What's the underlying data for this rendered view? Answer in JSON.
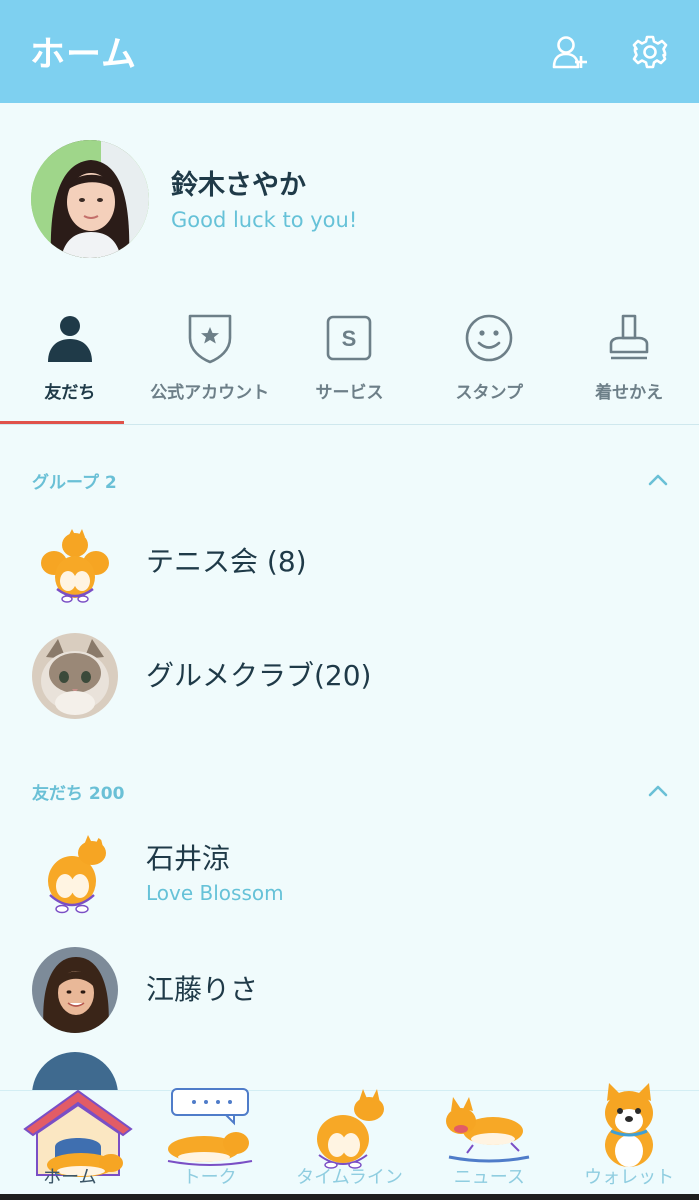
{
  "header": {
    "title": "ホーム",
    "icons": [
      "add-friend-icon",
      "settings-icon"
    ]
  },
  "profile": {
    "name": "鈴木さやか",
    "status": "Good luck to you!"
  },
  "tabs": [
    {
      "label": "友だち",
      "icon": "person-icon",
      "active": true
    },
    {
      "label": "公式アカウント",
      "icon": "official-account-icon",
      "active": false
    },
    {
      "label": "サービス",
      "icon": "services-icon",
      "active": false
    },
    {
      "label": "スタンプ",
      "icon": "smiley-icon",
      "active": false
    },
    {
      "label": "着せかえ",
      "icon": "theme-brush-icon",
      "active": false
    }
  ],
  "groups_section": {
    "title": "グループ 2",
    "items": [
      {
        "name": "テニス会 (8)"
      },
      {
        "name": "グルメクラブ(20)"
      }
    ]
  },
  "friends_section": {
    "title": "友だち 200",
    "items": [
      {
        "name": "石井涼",
        "status": "Love Blossom"
      },
      {
        "name": "江藤りさ"
      }
    ]
  },
  "bottom_nav": [
    {
      "label": "ホーム",
      "icon": "home-doghouse-icon",
      "active": true
    },
    {
      "label": "トーク",
      "icon": "talk-sleeping-dog-icon",
      "active": false
    },
    {
      "label": "タイムライン",
      "icon": "timeline-dog-icon",
      "active": false
    },
    {
      "label": "ニュース",
      "icon": "news-running-dog-icon",
      "active": false
    },
    {
      "label": "ウォレット",
      "icon": "wallet-dog-icon",
      "active": false
    }
  ],
  "colors": {
    "header_bg": "#7ed0f0",
    "page_bg": "#f0fbfc",
    "accent_text": "#66c2d8",
    "active_tab_underline": "#e0524a",
    "primary_text": "#1f3a48"
  }
}
